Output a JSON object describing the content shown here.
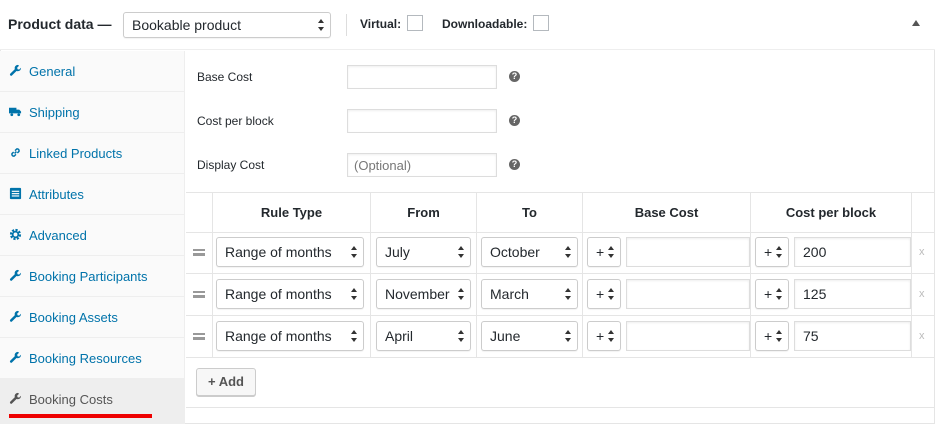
{
  "header": {
    "title": "Product data —",
    "product_type": "Bookable product",
    "virtual_label": "Virtual:",
    "downloadable_label": "Downloadable:"
  },
  "sidebar": {
    "items": [
      {
        "label": "General",
        "icon": "wrench-icon"
      },
      {
        "label": "Shipping",
        "icon": "truck-icon"
      },
      {
        "label": "Linked Products",
        "icon": "link-icon"
      },
      {
        "label": "Attributes",
        "icon": "list-icon"
      },
      {
        "label": "Advanced",
        "icon": "gear-icon"
      },
      {
        "label": "Booking Participants",
        "icon": "wrench-icon"
      },
      {
        "label": "Booking Assets",
        "icon": "wrench-icon"
      },
      {
        "label": "Booking Resources",
        "icon": "wrench-icon"
      },
      {
        "label": "Booking Costs",
        "icon": "wrench-icon",
        "active": true
      }
    ]
  },
  "fields": {
    "base_cost": {
      "label": "Base Cost",
      "value": ""
    },
    "cost_per_block": {
      "label": "Cost per block",
      "value": ""
    },
    "display_cost": {
      "label": "Display Cost",
      "placeholder": "(Optional)"
    }
  },
  "table": {
    "headers": [
      "Rule Type",
      "From",
      "To",
      "Base Cost",
      "Cost per block"
    ],
    "rows": [
      {
        "rule_type": "Range of months",
        "from": "July",
        "to": "October",
        "base_op": "+",
        "base_cost": "",
        "block_op": "+",
        "block_cost": "200",
        "remove": "x"
      },
      {
        "rule_type": "Range of months",
        "from": "November",
        "to": "March",
        "base_op": "+",
        "base_cost": "",
        "block_op": "+",
        "block_cost": "125",
        "remove": "x"
      },
      {
        "rule_type": "Range of months",
        "from": "April",
        "to": "June",
        "base_op": "+",
        "base_cost": "",
        "block_op": "+",
        "block_cost": "75",
        "remove": "x"
      }
    ],
    "add_label": "+ Add"
  },
  "colors": {
    "link": "#0073aa",
    "active_underline": "#e00000"
  }
}
